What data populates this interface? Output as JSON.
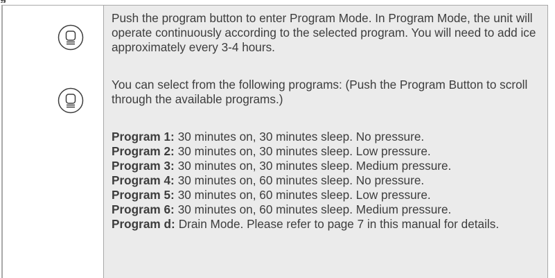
{
  "row1": {
    "text": "Push the program button to enter Program Mode. In Program Mode, the unit will operate continuously according to the selected program. You will need to add ice approximately every 3-4 hours.",
    "icon": "program-button-icon"
  },
  "row2": {
    "icon": "program-button-icon",
    "intro": "You can select from the following programs: (Push the Program Button to scroll through the available programs.)",
    "programs": [
      {
        "label": "Program 1:",
        "text": "30 minutes on, 30 minutes sleep. No pressure."
      },
      {
        "label": "Program 2:",
        "text": "30 minutes on, 30 minutes sleep. Low pressure."
      },
      {
        "label": "Program 3:",
        "text": "30 minutes on, 30 minutes sleep. Medium pressure."
      },
      {
        "label": "Program 4:",
        "text": "30 minutes on, 60 minutes sleep. No pressure."
      },
      {
        "label": "Program 5:",
        "text": "30 minutes on, 60 minutes sleep. Low pressure."
      },
      {
        "label": "Program 6:",
        "text": "30 minutes on, 60 minutes sleep. Medium pressure."
      },
      {
        "label": "Program d:",
        "text": "Drain Mode. Please refer to page 7 in this manual for details."
      }
    ]
  },
  "colors": {
    "text": "#3d3d3d",
    "text_cell_bg": "#ebebeb",
    "rule": "#a8a8a8"
  }
}
